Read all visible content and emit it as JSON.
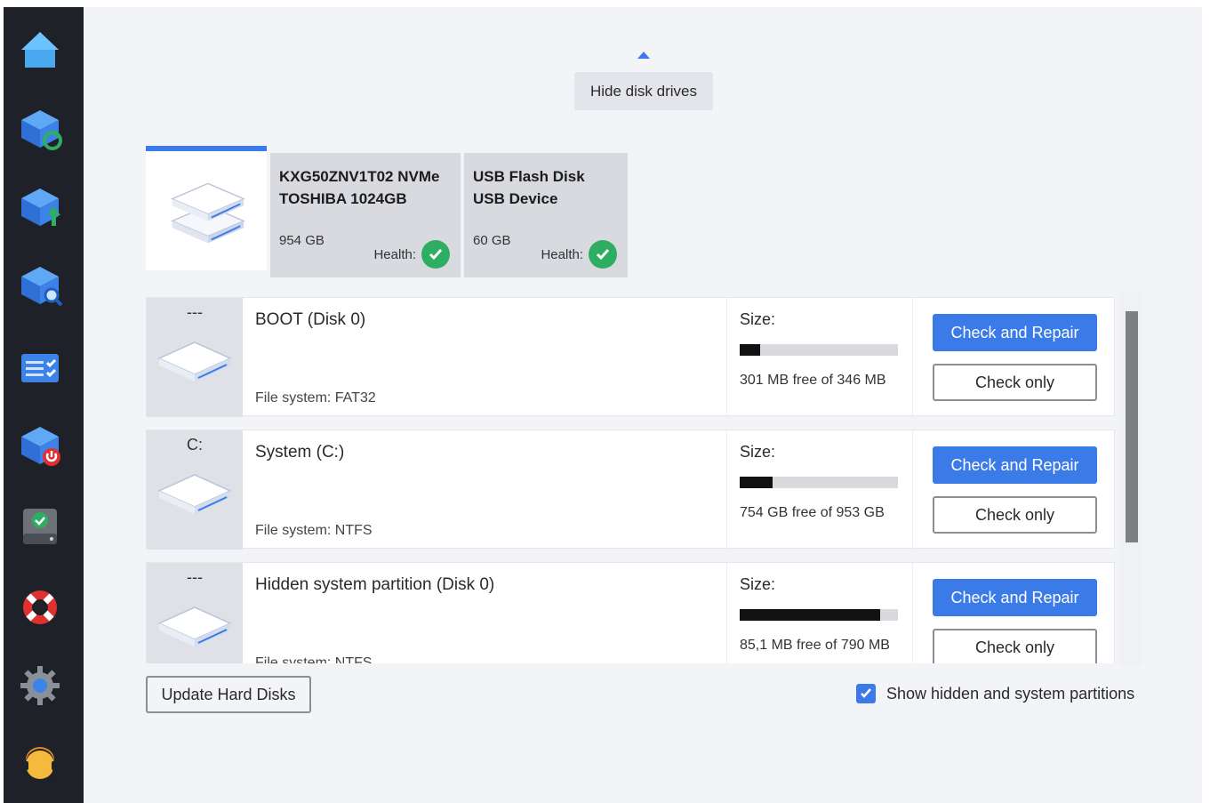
{
  "sidebar": {
    "items": [
      {
        "icon": "home-icon"
      },
      {
        "icon": "backup-restore-icon"
      },
      {
        "icon": "upload-icon"
      },
      {
        "icon": "search-disk-icon"
      },
      {
        "icon": "task-list-icon"
      },
      {
        "icon": "shutdown-icon"
      },
      {
        "icon": "hard-disk-check-icon"
      },
      {
        "icon": "lifebuoy-icon"
      },
      {
        "icon": "gear-icon"
      },
      {
        "icon": "support-agent-icon"
      }
    ]
  },
  "disk_toggle": {
    "label": "Hide disk drives"
  },
  "disks": [
    {
      "name": "KXG50ZNV1T02 NVMe TOSHIBA 1024GB",
      "size": "954 GB",
      "health_label": "Health:",
      "health_status": "ok"
    },
    {
      "name": "USB Flash Disk USB Device",
      "size": "60 GB",
      "health_label": "Health:",
      "health_status": "ok"
    }
  ],
  "partitions": [
    {
      "letter": "---",
      "name": "BOOT (Disk 0)",
      "filesystem": "File system: FAT32",
      "size_label": "Size:",
      "used_fraction": 0.13,
      "free_text": "301 MB free of 346 MB",
      "repair_label": "Check and Repair",
      "check_label": "Check only"
    },
    {
      "letter": "C:",
      "name": "System (C:)",
      "filesystem": "File system: NTFS",
      "size_label": "Size:",
      "used_fraction": 0.21,
      "free_text": "754 GB free of 953 GB",
      "repair_label": "Check and Repair",
      "check_label": "Check only"
    },
    {
      "letter": "---",
      "name": "Hidden system partition (Disk 0)",
      "filesystem": "File system: NTFS",
      "size_label": "Size:",
      "used_fraction": 0.89,
      "free_text": "85,1 MB free of 790 MB",
      "repair_label": "Check and Repair",
      "check_label": "Check only"
    }
  ],
  "footer": {
    "update_label": "Update Hard Disks",
    "show_hidden_label": "Show hidden and system partitions",
    "show_hidden_checked": true
  },
  "colors": {
    "accent": "#3b7be8",
    "sidebar_bg": "#1e2128",
    "health_ok": "#2eae62",
    "content_bg": "#f3f4f8"
  }
}
